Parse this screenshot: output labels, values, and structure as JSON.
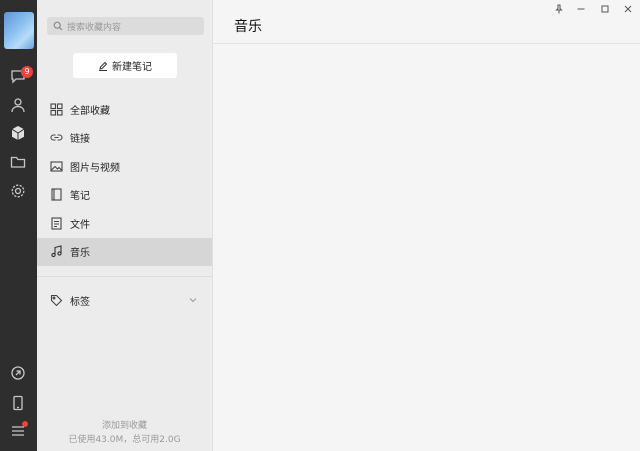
{
  "rail": {
    "badge_count": "9"
  },
  "search": {
    "placeholder": "搜索收藏内容"
  },
  "new_note": {
    "label": "新建笔记"
  },
  "nav": {
    "items": [
      {
        "label": "全部收藏",
        "icon": "grid-icon"
      },
      {
        "label": "链接",
        "icon": "link-icon"
      },
      {
        "label": "图片与视频",
        "icon": "image-icon"
      },
      {
        "label": "笔记",
        "icon": "notebook-icon"
      },
      {
        "label": "文件",
        "icon": "file-icon"
      },
      {
        "label": "音乐",
        "icon": "music-icon"
      }
    ],
    "active_index": 5
  },
  "tags": {
    "label": "标签"
  },
  "footer": {
    "add_label": "添加到收藏",
    "storage": "已使用43.0M，总可用2.0G"
  },
  "content": {
    "title": "音乐"
  },
  "colors": {
    "rail_bg": "#2e2e2e",
    "badge": "#e8453c",
    "panel_bg": "#ececec",
    "active_bg": "#d6d6d6"
  }
}
